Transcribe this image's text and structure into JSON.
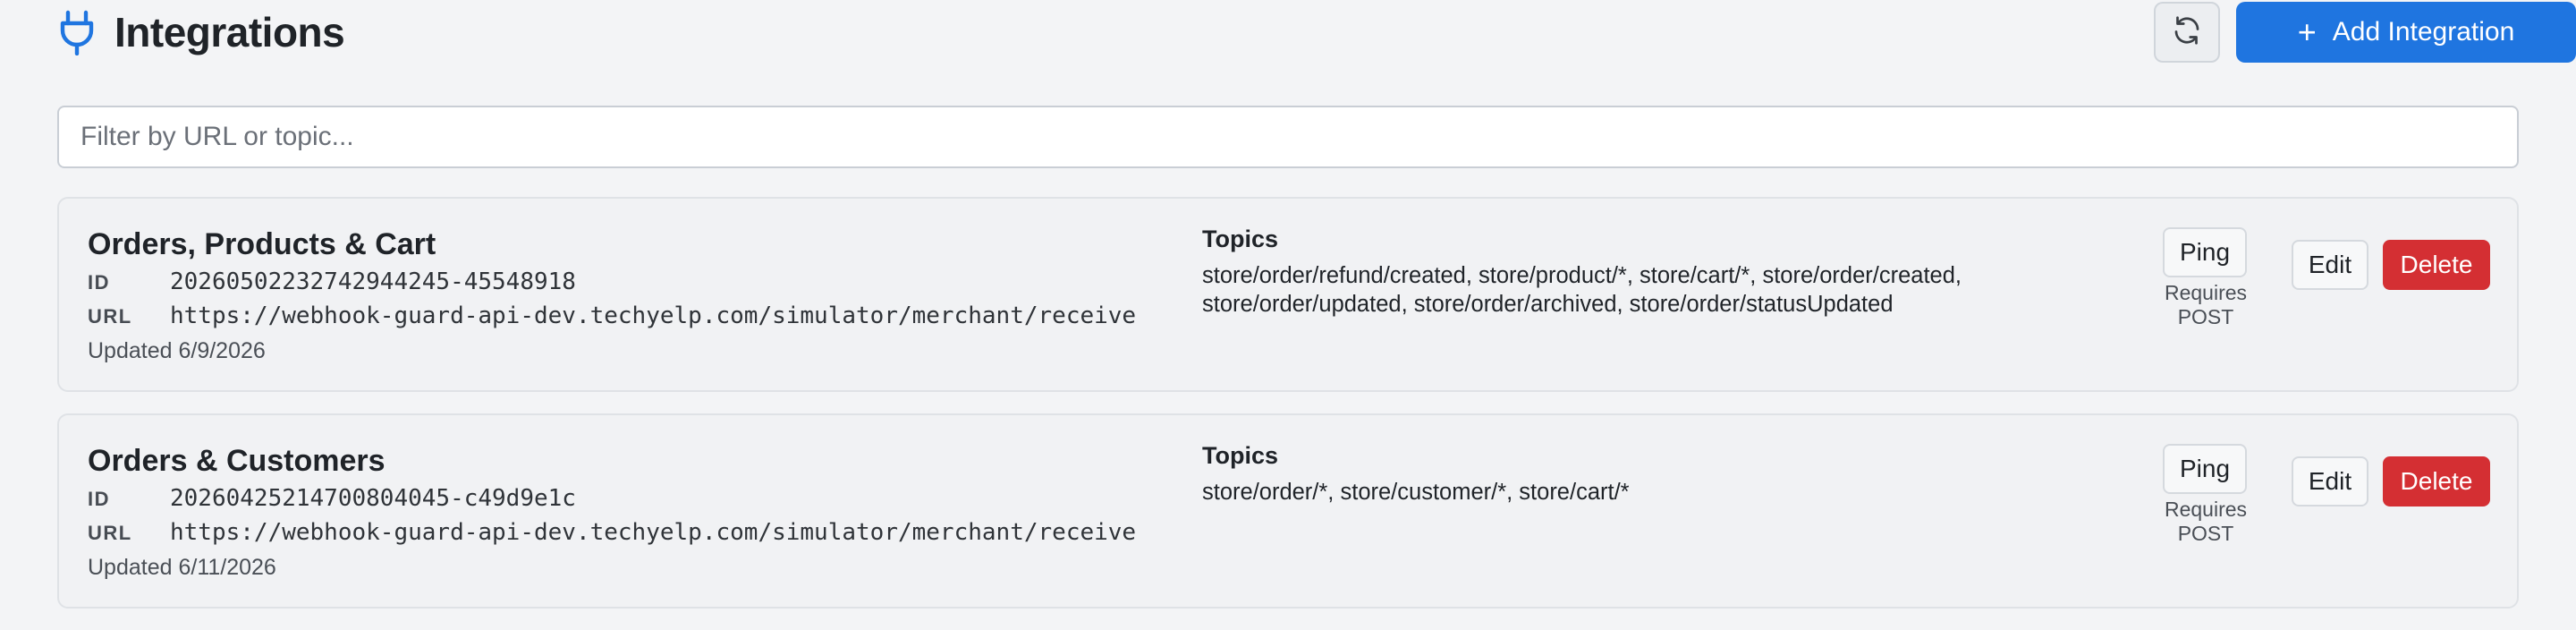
{
  "header": {
    "icon": "plug-icon",
    "title": "Integrations",
    "refresh_icon": "refresh-icon",
    "add_label": "Add Integration",
    "accent_color": "#1f75e0"
  },
  "filter": {
    "placeholder": "Filter by URL or topic...",
    "value": ""
  },
  "labels": {
    "id": "ID",
    "url": "URL",
    "topics": "Topics",
    "ping": "Ping",
    "ping_note": "Requires POST",
    "edit": "Edit",
    "delete": "Delete",
    "delete_color": "#d42f33"
  },
  "integrations": [
    {
      "name": "Orders, Products & Cart",
      "id": "20260502232742944245-45548918",
      "url": "https://webhook-guard-api-dev.techyelp.com/simulator/merchant/receive",
      "updated": "Updated 6/9/2026",
      "topics": "store/order/refund/created, store/product/*, store/cart/*, store/order/created, store/order/updated, store/order/archived, store/order/statusUpdated"
    },
    {
      "name": "Orders & Customers",
      "id": "20260425214700804045-c49d9e1c",
      "url": "https://webhook-guard-api-dev.techyelp.com/simulator/merchant/receive",
      "updated": "Updated 6/11/2026",
      "topics": "store/order/*, store/customer/*, store/cart/*"
    }
  ]
}
